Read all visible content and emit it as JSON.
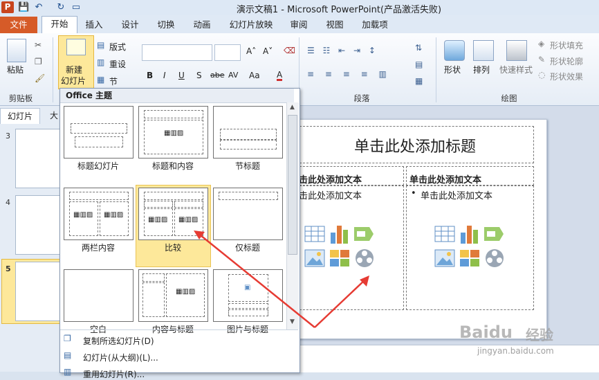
{
  "window": {
    "title": "演示文稿1 - Microsoft PowerPoint(产品激活失败)"
  },
  "app_icon": "P",
  "tabs": {
    "file": "文件",
    "home": "开始",
    "insert": "插入",
    "design": "设计",
    "transitions": "切换",
    "animations": "动画",
    "slideshow": "幻灯片放映",
    "review": "审阅",
    "view": "视图",
    "addins": "加载项"
  },
  "ribbon": {
    "paste": "粘贴",
    "clipboard": "剪贴板",
    "new_slide_line1": "新建",
    "new_slide_line2": "幻灯片",
    "layout": "版式",
    "reset": "重设",
    "section": "节",
    "paragraph": "段落",
    "drawing": "绘图",
    "shapes": "形状",
    "arrange": "排列",
    "quick_styles": "快速样式",
    "shape_fill": "形状填充",
    "shape_outline": "形状轮廓",
    "shape_effects": "形状效果",
    "font_bold": "B",
    "font_italic": "I",
    "font_underline": "U",
    "font_strike": "S",
    "font_abc": "abe",
    "font_av": "AV",
    "font_aa": "Aa",
    "font_color": "A"
  },
  "slide_panel": {
    "tab_slides": "幻灯片",
    "tab_outline": "大",
    "numbers": [
      "3",
      "4",
      "5"
    ]
  },
  "dropdown": {
    "header": "Office 主题",
    "layouts": [
      {
        "label": "标题幻灯片"
      },
      {
        "label": "标题和内容"
      },
      {
        "label": "节标题"
      },
      {
        "label": "两栏内容"
      },
      {
        "label": "比较"
      },
      {
        "label": "仅标题"
      },
      {
        "label": "空白"
      },
      {
        "label": "内容与标题"
      },
      {
        "label": "图片与标题"
      }
    ],
    "menu": [
      "复制所选幻灯片(D)",
      "幻灯片(从大纲)(L)...",
      "重用幻灯片(R)..."
    ]
  },
  "slide": {
    "title": "单击此处添加标题",
    "left_header": "击此处添加文本",
    "left_bullet": "击此处添加文本",
    "right_header": "单击此处添加文本",
    "right_bullet": "单击此处添加文本",
    "bullet": "•"
  },
  "watermark": {
    "brand": "Baidu",
    "cn": "经验",
    "url": "jingyan.baidu.com"
  },
  "colors": {
    "file_tab": "#d65b28",
    "selected_layout": "#fde89a",
    "arrow": "#e63b33"
  }
}
